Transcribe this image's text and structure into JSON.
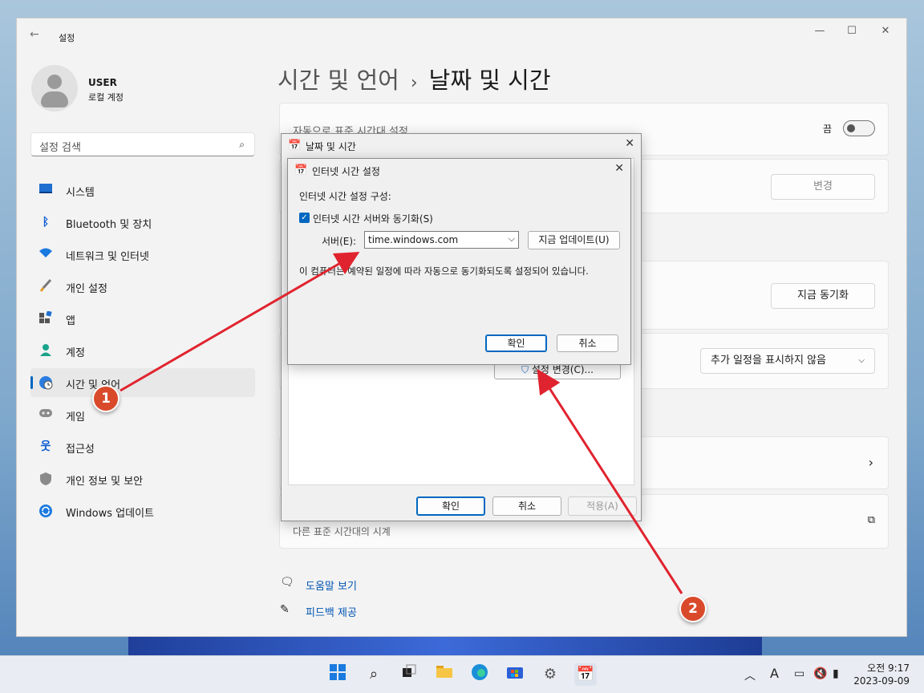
{
  "window": {
    "app_title": "설정",
    "back_icon": "back-arrow-icon"
  },
  "user": {
    "name": "USER",
    "account_type": "로컬 계정"
  },
  "search": {
    "placeholder": "설정 검색"
  },
  "nav": [
    {
      "label": "시스템",
      "icon": "system-icon"
    },
    {
      "label": "Bluetooth 및 장치",
      "icon": "bluetooth-icon"
    },
    {
      "label": "네트워크 및 인터넷",
      "icon": "wifi-icon"
    },
    {
      "label": "개인 설정",
      "icon": "brush-icon"
    },
    {
      "label": "앱",
      "icon": "apps-icon"
    },
    {
      "label": "계정",
      "icon": "account-icon"
    },
    {
      "label": "시간 및 언어",
      "icon": "time-language-icon",
      "active": true
    },
    {
      "label": "게임",
      "icon": "gamepad-icon"
    },
    {
      "label": "접근성",
      "icon": "accessibility-icon"
    },
    {
      "label": "개인 정보 및 보안",
      "icon": "shield-icon"
    },
    {
      "label": "Windows 업데이트",
      "icon": "update-icon"
    }
  ],
  "breadcrumb": {
    "parent": "시간 및 언어",
    "current": "날짜 및 시간"
  },
  "cards": {
    "auto_timezone_label": "자동으로 표준 시간대 설정",
    "auto_timezone_state": "끔",
    "change_button": "변경",
    "sync_button": "지금 동기화",
    "calendar_dropdown": "추가 일정을 표시하지 않음",
    "other_timezone_clock": "다른 표준 시간대의 시계"
  },
  "links": {
    "help": "도움말 보기",
    "feedback": "피드백 제공"
  },
  "datetime_dialog": {
    "title": "날짜 및 시간",
    "change_settings_button": "설정 변경(C)...",
    "ok": "확인",
    "cancel": "취소",
    "apply": "적용(A)"
  },
  "internet_time_dialog": {
    "title": "인터넷 시간 설정",
    "section_label": "인터넷 시간 설정 구성:",
    "sync_checkbox_label": "인터넷 시간 서버와 동기화(S)",
    "sync_checked": true,
    "server_label": "서버(E):",
    "server_value": "time.windows.com",
    "update_now_button": "지금 업데이트(U)",
    "status_text": "이 컴퓨터는 예약된 일정에 따라 자동으로 동기화되도록 설정되어 있습니다.",
    "ok": "확인",
    "cancel": "취소"
  },
  "annotations": {
    "marker1": "1",
    "marker2": "2",
    "color": "#e0242f"
  },
  "taskbar": {
    "icons": [
      "windows-start-icon",
      "search-icon",
      "task-view-icon",
      "file-explorer-icon",
      "edge-icon",
      "store-icon",
      "settings-icon",
      "datetime-app-icon"
    ],
    "tray": [
      "chevron-up-icon",
      "input-indicator-icon",
      "display-icon",
      "volume-muted-icon",
      "battery-icon"
    ],
    "ime": "A",
    "time": "오전 9:17",
    "date": "2023-09-09"
  }
}
